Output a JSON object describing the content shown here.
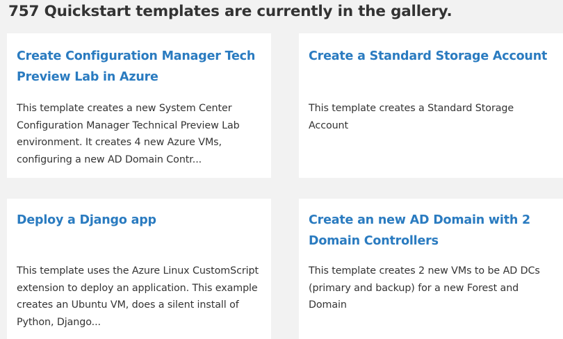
{
  "gallery": {
    "heading": "757 Quickstart templates are currently in the gallery."
  },
  "cards": [
    {
      "title": "Create Configuration Manager Tech Preview Lab in Azure",
      "description": "This template creates a new System Center Configuration Manager Technical Preview Lab environment. It creates 4 new Azure VMs, configuring a new AD Domain Contr..."
    },
    {
      "title": "Create a Standard Storage Account",
      "description": "This template creates a Standard Storage Account"
    },
    {
      "title": "Deploy a Django app",
      "description": "This template uses the Azure Linux CustomScript extension to deploy an application. This example creates an Ubuntu VM, does a silent install of Python, Django..."
    },
    {
      "title": "Create an new AD Domain with 2 Domain Controllers",
      "description": "This template creates 2 new VMs to be AD DCs (primary and backup) for a new Forest and Domain"
    }
  ]
}
